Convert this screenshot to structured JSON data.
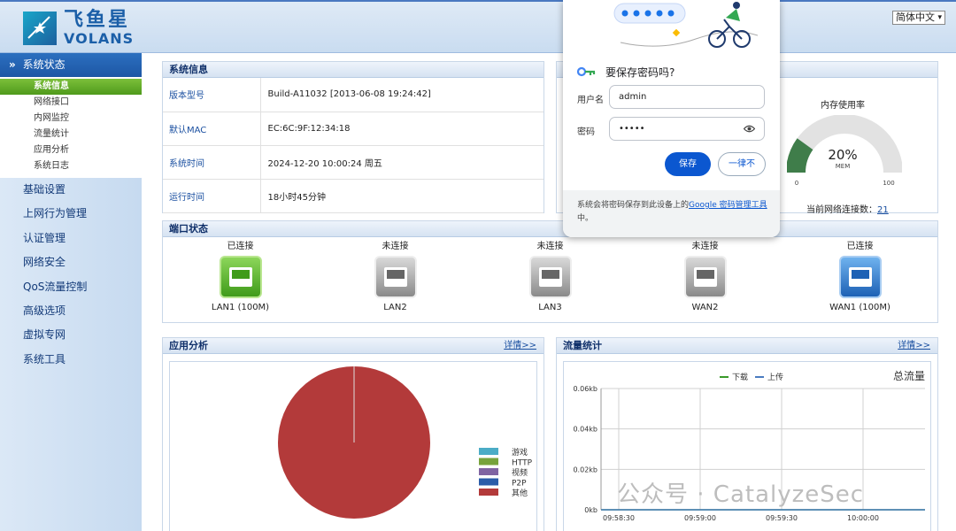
{
  "header": {
    "logo_cn": "飞鱼星",
    "logo_en": "VOLANS",
    "language": "简体中文"
  },
  "sidebar": {
    "section_title": "系统状态",
    "sub_items": [
      {
        "label": "系统信息",
        "active": true
      },
      {
        "label": "网络接口",
        "active": false
      },
      {
        "label": "内网监控",
        "active": false
      },
      {
        "label": "流量统计",
        "active": false
      },
      {
        "label": "应用分析",
        "active": false
      },
      {
        "label": "系统日志",
        "active": false
      }
    ],
    "items": [
      "基础设置",
      "上网行为管理",
      "认证管理",
      "网络安全",
      "QoS流量控制",
      "高级选项",
      "虚拟专网",
      "系统工具"
    ]
  },
  "system_info": {
    "title": "系统信息",
    "rows": [
      {
        "key": "版本型号",
        "value": "Build-A11032 [2013-06-08 19:24:42]"
      },
      {
        "key": "默认MAC",
        "value": "EC:6C:9F:12:34:18"
      },
      {
        "key": "系统时间",
        "value": "2024-12-20 10:00:24 周五"
      },
      {
        "key": "运行时间",
        "value": "18小时45分钟"
      }
    ]
  },
  "resource": {
    "mem_title": "内存使用率",
    "mem_percent": 20,
    "mem_value": "20%",
    "mem_label": "MEM",
    "gauge_min": "0",
    "gauge_max": "100",
    "conn_label": "当前网络连接数：",
    "conn_count": "21"
  },
  "port_status": {
    "title": "端口状态",
    "ports": [
      {
        "status": "已连接",
        "name": "LAN1 (100M)",
        "color": "green"
      },
      {
        "status": "未连接",
        "name": "LAN2",
        "color": "gray"
      },
      {
        "status": "未连接",
        "name": "LAN3",
        "color": "gray"
      },
      {
        "status": "未连接",
        "name": "WAN2",
        "color": "gray"
      },
      {
        "status": "已连接",
        "name": "WAN1 (100M)",
        "color": "blue"
      }
    ]
  },
  "app_analysis": {
    "title": "应用分析",
    "more": "详情>>"
  },
  "traffic": {
    "title": "流量统计",
    "more": "详情>>"
  },
  "chart_data": [
    {
      "type": "pie",
      "categories": [
        "游戏",
        "HTTP",
        "视频",
        "P2P",
        "其他"
      ],
      "values": [
        0,
        0,
        0,
        0,
        100
      ],
      "colors": [
        "#4bacc6",
        "#77a33b",
        "#8064a2",
        "#2a5ca8",
        "#b33a3a"
      ],
      "legend_position": "bottom-right"
    },
    {
      "type": "line",
      "title": "总流量",
      "x": [
        "09:58:30",
        "09:59:00",
        "09:59:30",
        "10:00:00"
      ],
      "y_ticks": [
        "0.06kb",
        "0.04kb",
        "0.02kb",
        "0kb"
      ],
      "ylim": [
        0,
        0.06
      ],
      "series": [
        {
          "name": "下载",
          "color": "#3a9a2a",
          "values": [
            0,
            0,
            0,
            0
          ]
        },
        {
          "name": "上传",
          "color": "#4a7cc0",
          "values": [
            0,
            0,
            0,
            0
          ]
        }
      ],
      "legend_position": "top",
      "grid": true
    }
  ],
  "password_popup": {
    "title": "要保存密码吗?",
    "username_label": "用户名",
    "username_value": "admin",
    "password_label": "密码",
    "password_value": "•••••",
    "save_label": "保存",
    "never_label": "一律不",
    "footer_text": "系统会将密码保存到此设备上的",
    "footer_link": "Google 密码管理工具",
    "footer_end": "中。"
  },
  "watermark": "公众号 · CatalyzeSec"
}
